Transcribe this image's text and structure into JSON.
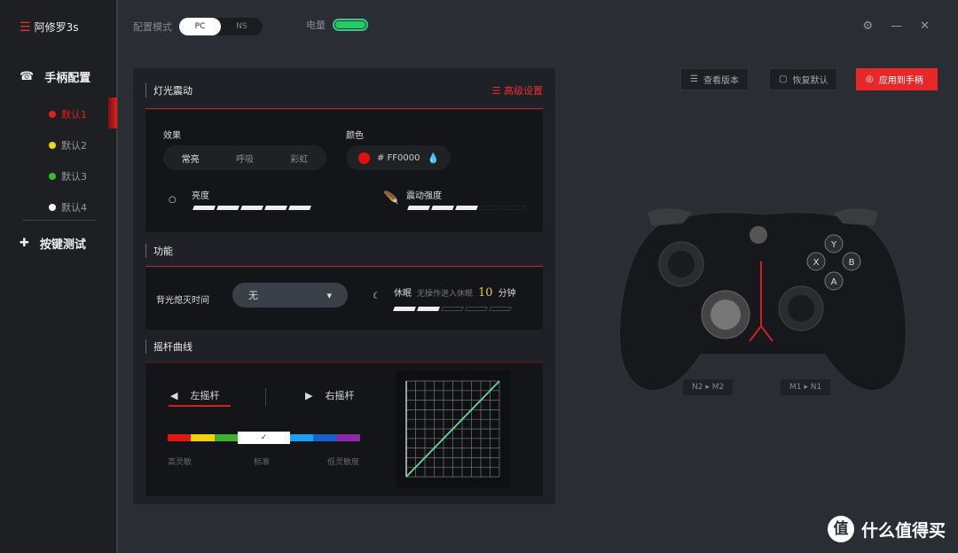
{
  "app": {
    "logo_text": "阿修罗3s"
  },
  "header": {
    "mode_label": "配置模式",
    "mode_options": [
      "PC",
      "NS"
    ],
    "mode_selected": "PC",
    "battery_label": "电量",
    "battery_level": 1.0
  },
  "sidebar": {
    "controller_config": "手柄配置",
    "profiles": [
      {
        "label": "默认1",
        "color": "#e02020",
        "active": true
      },
      {
        "label": "默认2",
        "color": "#e8d820"
      },
      {
        "label": "默认3",
        "color": "#30c030"
      },
      {
        "label": "默认4",
        "color": "#ffffff"
      }
    ],
    "key_test": "按键测试"
  },
  "lighting": {
    "title": "灯光震动",
    "advanced": "高级设置",
    "effect_label": "效果",
    "effects": [
      "常亮",
      "呼吸",
      "彩虹"
    ],
    "effect_selected": "常亮",
    "color_label": "颜色",
    "color_value": "# FF0000",
    "color_swatch": "#e01010",
    "brightness_label": "亮度",
    "brightness_level": 5,
    "vibration_label": "震动强度",
    "vibration_level": 3,
    "levels_total": 5
  },
  "function": {
    "title": "功能",
    "backlight_label": "背光熄灭时间",
    "backlight_value": "无",
    "sleep_label": "休眠",
    "sleep_desc": "无操作进入休眠",
    "sleep_value": "10",
    "sleep_unit": "分钟",
    "sleep_level": 2
  },
  "stick": {
    "title": "摇杆曲线",
    "left": "左摇杆",
    "right": "右摇杆",
    "selected": "左摇杆",
    "scale_labels": [
      "高灵敏",
      "标准",
      "低灵敏度"
    ],
    "scale_colors": [
      "#e01515",
      "#f0d010",
      "#40b030",
      "#ffffff",
      "#1ea0f0",
      "#1a60c8",
      "#8a2aa8"
    ],
    "selected_index": 3
  },
  "actions": {
    "version": "查看版本",
    "reset": "恢复默认",
    "apply": "应用到手柄"
  },
  "controller": {
    "left_paddle": "N2 ▸ M2",
    "right_paddle": "M1 ▸ N1",
    "face_buttons": [
      "Y",
      "X",
      "B",
      "A"
    ]
  },
  "window": {
    "settings": "⚙",
    "minimize": "—",
    "close": "✕"
  },
  "watermark": "什么值得买"
}
